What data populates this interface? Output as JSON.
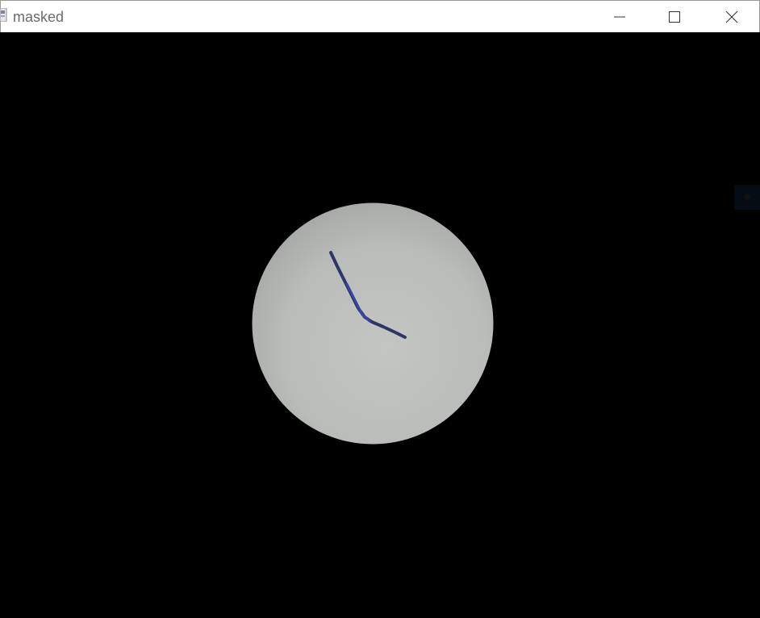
{
  "window": {
    "title": "masked",
    "controls": {
      "minimize": "minimize-icon",
      "maximize": "maximize-icon",
      "close": "close-icon"
    }
  },
  "colors": {
    "titlebar_bg": "#ffffff",
    "title_text": "#6b6b6b",
    "canvas_bg": "#000000",
    "disc": "#b9bcb9",
    "ink": "#2e3570"
  }
}
